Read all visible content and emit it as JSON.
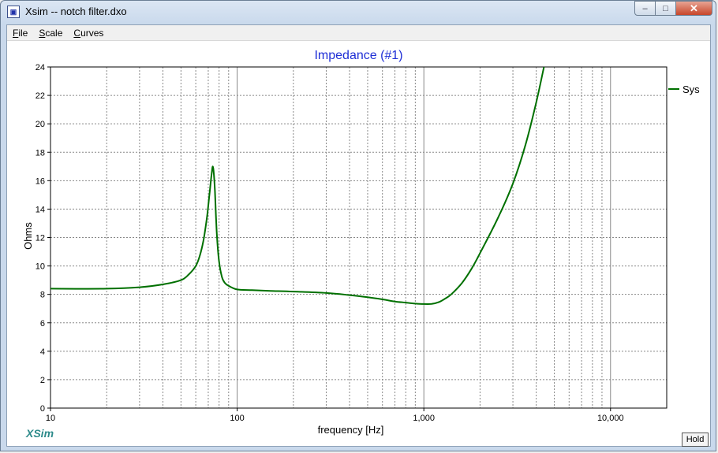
{
  "window": {
    "title": "Xsim -- notch filter.dxo",
    "icon_name": "xsim-app-icon",
    "minimize_glyph": "‒",
    "maximize_glyph": "□",
    "close_glyph": "✕"
  },
  "menubar": {
    "items": [
      {
        "label": "File",
        "accel": "F",
        "rest": "ile"
      },
      {
        "label": "Scale",
        "accel": "S",
        "rest": "cale"
      },
      {
        "label": "Curves",
        "accel": "C",
        "rest": "urves"
      }
    ]
  },
  "branding": {
    "logo_text": "XSim"
  },
  "controls": {
    "hold_label": "Hold"
  },
  "colors": {
    "curve": "#007000",
    "title": "#1f2fd6",
    "axis": "#000000",
    "grid": "#888888"
  },
  "chart_data": {
    "type": "line",
    "title": "Impedance (#1)",
    "xlabel": "frequency [Hz]",
    "ylabel": "Ohms",
    "xscale": "log",
    "xlim": [
      10,
      20000
    ],
    "ylim": [
      0,
      24
    ],
    "yticks": [
      0,
      2,
      4,
      6,
      8,
      10,
      12,
      14,
      16,
      18,
      20,
      22,
      24
    ],
    "xticks": [
      {
        "value": 10,
        "label": "10"
      },
      {
        "value": 100,
        "label": "100"
      },
      {
        "value": 1000,
        "label": "1,000"
      },
      {
        "value": 10000,
        "label": "10,000"
      }
    ],
    "grid": true,
    "legend_position": "right",
    "series": [
      {
        "name": "Sys",
        "color": "#007000",
        "x": [
          10,
          20,
          30,
          40,
          50,
          55,
          60,
          63,
          66,
          69,
          71,
          73,
          74,
          75,
          76,
          77,
          78,
          80,
          83,
          86,
          90,
          100,
          120,
          150,
          200,
          300,
          400,
          500,
          600,
          700,
          800,
          900,
          1000,
          1100,
          1200,
          1300,
          1400,
          1600,
          1800,
          2000,
          2500,
          3000,
          3500,
          4000,
          4400
        ],
        "y": [
          8.4,
          8.4,
          8.5,
          8.7,
          9.0,
          9.4,
          10.0,
          10.7,
          11.8,
          13.5,
          15.0,
          16.5,
          17.0,
          16.5,
          15.3,
          13.5,
          12.0,
          10.3,
          9.2,
          8.8,
          8.6,
          8.35,
          8.3,
          8.25,
          8.2,
          8.1,
          7.95,
          7.8,
          7.65,
          7.5,
          7.42,
          7.35,
          7.32,
          7.33,
          7.45,
          7.7,
          8.0,
          8.8,
          9.8,
          10.9,
          13.4,
          15.8,
          18.5,
          21.5,
          24.0
        ]
      }
    ]
  }
}
